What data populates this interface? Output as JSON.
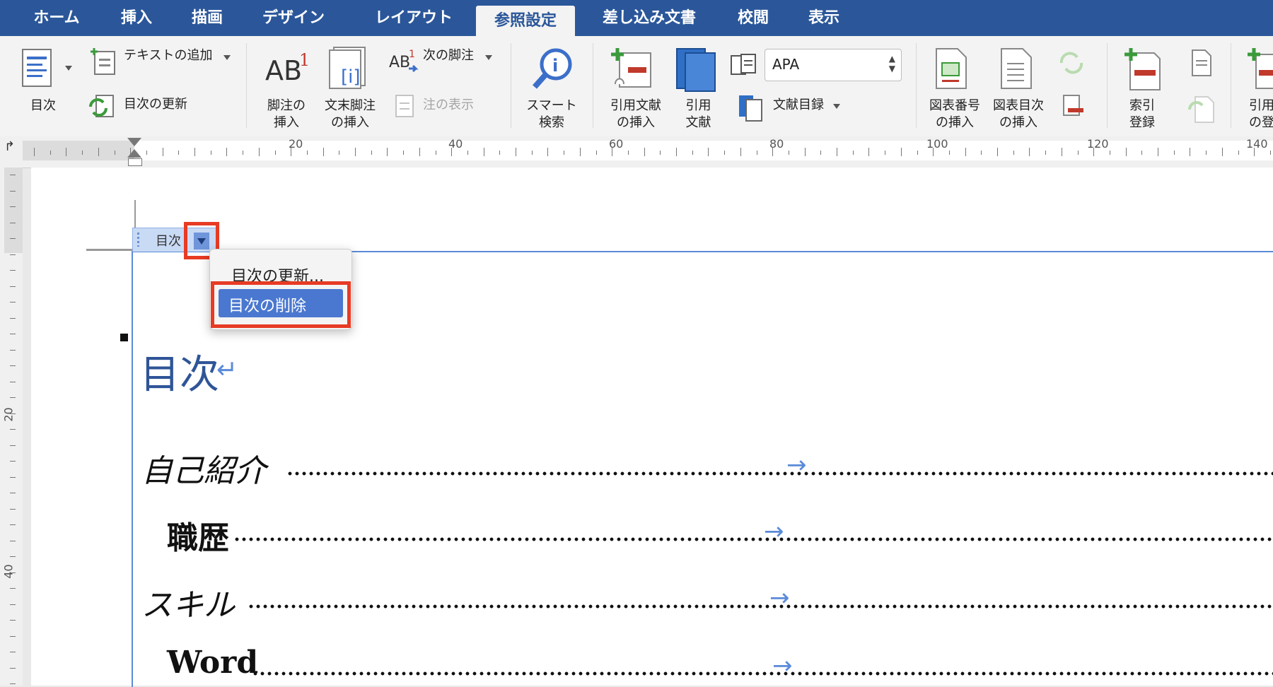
{
  "tabs": [
    {
      "label": "ホーム"
    },
    {
      "label": "挿入"
    },
    {
      "label": "描画"
    },
    {
      "label": "デザイン"
    },
    {
      "label": "レイアウト"
    },
    {
      "label": "参照設定",
      "active": true
    },
    {
      "label": "差し込み文書"
    },
    {
      "label": "校閲"
    },
    {
      "label": "表示"
    }
  ],
  "ribbon": {
    "toc": "目次",
    "add_text": "テキストの追加",
    "update_toc": "目次の更新",
    "footnote_insert": "脚注の\n挿入",
    "endnote_insert": "文末脚注\nの挿入",
    "next_footnote": "次の脚注",
    "show_notes": "注の表示",
    "smart_lookup": "スマート\n検索",
    "insert_citation": "引用文献\nの挿入",
    "citations": "引用\n文献",
    "style_value": "APA",
    "bibliography": "文献目録",
    "insert_caption": "図表番号\nの挿入",
    "insert_table_of_figures": "図表目次\nの挿入",
    "mark_entry": "索引\n登録",
    "mark_citation": "引用\nの登"
  },
  "ruler": {
    "labels": [
      "20",
      "40",
      "60",
      "80",
      "100",
      "120",
      "140"
    ],
    "vlabels": [
      "20",
      "40"
    ]
  },
  "document": {
    "toc_tab_label": "目次",
    "toc_menu": {
      "update": "目次の更新...",
      "delete": "目次の削除"
    },
    "toc_title": "目次",
    "entries": [
      {
        "text": "自己紹介"
      },
      {
        "text": "職歴"
      },
      {
        "text": "スキル"
      },
      {
        "text": "Word"
      }
    ]
  },
  "colors": {
    "accent": "#2b579a",
    "highlight": "#e73b24",
    "menu_selection": "#4a78d0"
  }
}
